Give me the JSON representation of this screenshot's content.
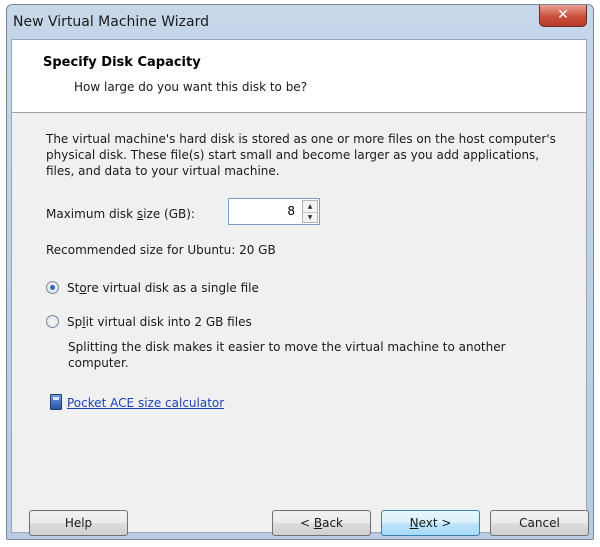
{
  "window": {
    "title": "New Virtual Machine Wizard",
    "close_glyph": "✕"
  },
  "header": {
    "title": "Specify Disk Capacity",
    "subtitle": "How large do you want this disk to be?"
  },
  "body": {
    "description": "The virtual machine's hard disk is stored as one or more files on the host computer's physical disk. These file(s) start small and become larger as you add applications, files, and data to your virtual machine.",
    "max_disk_label": "Maximum disk size (GB):",
    "max_disk_value": "8",
    "recommended": "Recommended size for Ubuntu: 20 GB",
    "options": [
      {
        "label": "Store virtual disk as a single file",
        "checked": true
      },
      {
        "label": "Split virtual disk into 2 GB files",
        "checked": false
      }
    ],
    "split_note": "Splitting the disk makes it easier to move the virtual machine to another computer.",
    "calculator_link": "Pocket ACE size calculator",
    "calculator_icon": "calculator-icon"
  },
  "buttons": {
    "help": "Help",
    "back": "< Back",
    "next": "Next >",
    "cancel": "Cancel"
  },
  "colors": {
    "link": "#1a43b8",
    "radio_selected": "#2d6db5",
    "default_button": "#bee6fd"
  }
}
